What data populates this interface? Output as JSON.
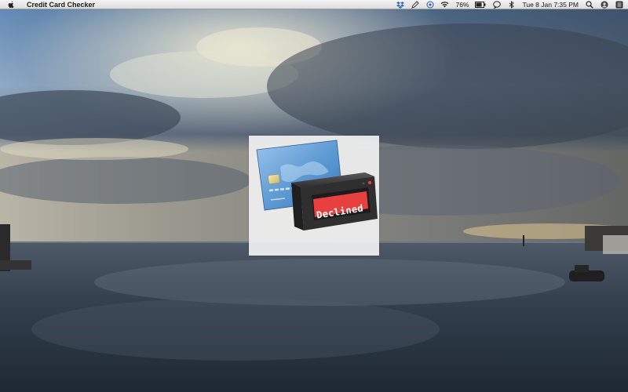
{
  "menubar": {
    "app_name": "Credit Card Checker",
    "battery_percent": "76%",
    "datetime": "Tue 8 Jan  7:35 PM",
    "icons": [
      "apple-icon",
      "dropbox-icon",
      "pen-icon",
      "location-icon",
      "wifi-icon",
      "battery-icon",
      "chat-icon",
      "bluetooth-icon",
      "search-icon",
      "user-icon",
      "list-icon"
    ]
  },
  "app": {
    "status_text": "Declined",
    "status_color": "#e8403f",
    "card_color": "#5f9bd4",
    "reader_color": "#3c3c3c"
  }
}
